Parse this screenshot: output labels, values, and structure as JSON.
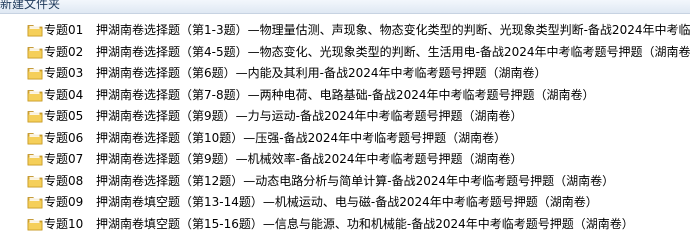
{
  "toolbar": {
    "new_folder_label": "新建文件夹"
  },
  "files": [
    {
      "prefix": "专题01",
      "title": "押湖南卷选择题（第1-3题）—物理量估测、声现象、物态变化类型的判断、光现象类型判断-备战2024年中考临"
    },
    {
      "prefix": "专题02",
      "title": "押湖南卷选择题（第4-5题）—物态变化、光现象类型的判断、生活用电-备战2024年中考临考题号押题（湖南卷"
    },
    {
      "prefix": "专题03",
      "title": "押湖南卷选择题（第6题）—内能及其利用-备战2024年中考临考题号押题（湖南卷）"
    },
    {
      "prefix": "专题04",
      "title": "押湖南卷选择题（第7-8题）—两种电荷、电路基础-备战2024年中考临考题号押题（湖南卷）"
    },
    {
      "prefix": "专题05",
      "title": "押湖南卷选择题（第9题）—力与运动-备战2024年中考临考题号押题（湖南卷）"
    },
    {
      "prefix": "专题06",
      "title": "押湖南卷选择题（第10题）—压强-备战2024年中考临考题号押题（湖南卷）"
    },
    {
      "prefix": "专题07",
      "title": "押湖南卷选择题（第9题）—机械效率-备战2024年中考临考题号押题（湖南卷）"
    },
    {
      "prefix": "专题08",
      "title": "押湖南卷选择题（第12题）—动态电路分析与简单计算-备战2024年中考临考题号押题（湖南卷）"
    },
    {
      "prefix": "专题09",
      "title": "押湖南卷填空题（第13-14题）—机械运动、电与磁-备战2024年中考临考题号押题（湖南卷）"
    },
    {
      "prefix": "专题10",
      "title": "押湖南卷填空题（第15-16题）—信息与能源、功和机械能-备战2024年中考临考题号押题（湖南卷）"
    }
  ],
  "icon": "folder-icon",
  "colors": {
    "folder_body": "#f2c94c",
    "folder_edge": "#c79a22",
    "toolbar_text": "#1e395b"
  }
}
